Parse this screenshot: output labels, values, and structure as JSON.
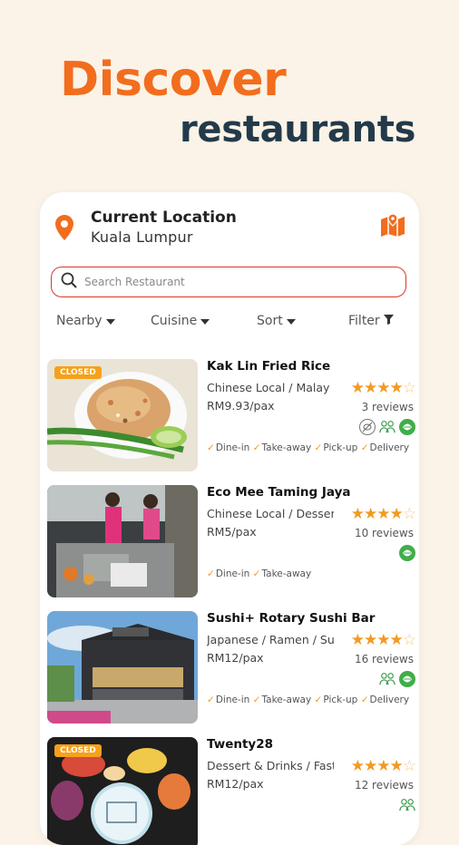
{
  "hero": {
    "title": "Discover",
    "subtitle": "restaurants"
  },
  "location": {
    "title": "Current Location",
    "city": "Kuala Lumpur"
  },
  "search": {
    "placeholder": "Search Restaurant"
  },
  "filters": [
    {
      "label": "Nearby",
      "icon": "caret-down-icon"
    },
    {
      "label": "Cuisine",
      "icon": "caret-down-icon"
    },
    {
      "label": "Sort",
      "icon": "caret-down-icon"
    },
    {
      "label": "Filter",
      "icon": "funnel-icon"
    }
  ],
  "restaurants": [
    {
      "name": "Kak Lin Fried Rice",
      "closed": "CLOSED",
      "cuisine": "Chinese Local / Malay",
      "price": "RM9.93/pax",
      "rating": 4.5,
      "reviews": "3 reviews",
      "badges": [
        "no-pork-icon",
        "family-icon",
        "halal-icon"
      ],
      "services": [
        "Dine-in",
        "Take-away",
        "Pick-up",
        "Delivery"
      ]
    },
    {
      "name": "Eco Mee Taming Jaya",
      "closed": "",
      "cuisine": "Chinese Local / Dessert",
      "price": "RM5/pax",
      "rating": 4.5,
      "reviews": "10 reviews",
      "badges": [
        "halal-icon"
      ],
      "services": [
        "Dine-in",
        "Take-away"
      ]
    },
    {
      "name": "Sushi+ Rotary Sushi Bar",
      "closed": "",
      "cuisine": "Japanese / Ramen / Sushi",
      "price": "RM12/pax",
      "rating": 4.5,
      "reviews": "16 reviews",
      "badges": [
        "family-icon",
        "halal-icon"
      ],
      "services": [
        "Dine-in",
        "Take-away",
        "Pick-up",
        "Delivery"
      ]
    },
    {
      "name": "Twenty28",
      "closed": "CLOSED",
      "cuisine": "Dessert & Drinks / Fast Food",
      "price": "RM12/pax",
      "rating": 4.5,
      "reviews": "12 reviews",
      "badges": [
        "family-icon"
      ],
      "services": []
    }
  ],
  "colors": {
    "accent": "#f26d1e",
    "navy": "#233a4a",
    "star": "#f29a21",
    "search_border": "#d7392a"
  }
}
